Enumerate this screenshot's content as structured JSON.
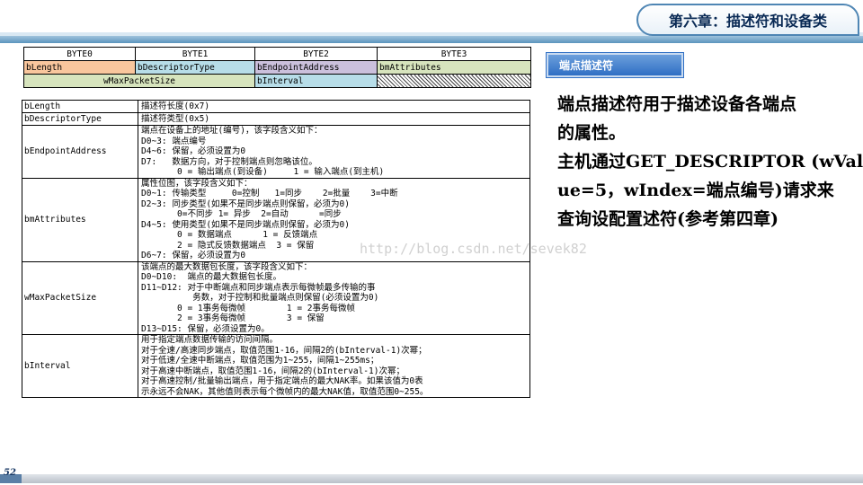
{
  "header": {
    "title": "第六章：描述符和设备类"
  },
  "byte_table": {
    "headers": [
      "BYTE0",
      "BYTE1",
      "BYTE2",
      "BYTE3"
    ],
    "row1": [
      "bLength",
      "bDescriptorType",
      "bEndpointAddress",
      "bmAttributes"
    ],
    "row2": [
      "wMaxPacketSize",
      "bInterval"
    ]
  },
  "fields": [
    {
      "name": "bLength",
      "lines": [
        "描述符长度(0x7)"
      ]
    },
    {
      "name": "bDescriptorType",
      "lines": [
        "描述符类型(0x5)"
      ]
    },
    {
      "name": "bEndpointAddress",
      "lines": [
        "端点在设备上的地址(编号)，该字段含义如下：",
        "D0~3: 端点编号",
        "D4~6: 保留，必须设置为0",
        "D7:   数据方向，对于控制端点则忽略该位。",
        "       0 = 输出端点(到设备)     1 = 输入端点(到主机)"
      ]
    },
    {
      "name": "bmAttributes",
      "lines": [
        "属性位图，该字段含义如下：",
        "D0~1: 传输类型     0=控制   1=同步    2=批量    3=中断",
        "D2~3: 同步类型(如果不是同步端点则保留，必须为0)",
        "       0=不同步 1= 异步  2=自动      =同步",
        "D4~5: 使用类型(如果不是同步端点则保留，必须为0)",
        "       0 = 数据端点      1 = 反馈端点",
        "       2 = 隐式反馈数据端点  3 = 保留",
        "D6~7: 保留，必须设置为0"
      ]
    },
    {
      "name": "wMaxPacketSize",
      "lines": [
        "该端点的最大数据包长度，该字段含义如下：",
        "D0~D10:  端点的最大数据包长度。",
        "D11~D12: 对于中断端点和同步端点表示每微帧最多传输的事",
        "          务数，对于控制和批量端点则保留(必须设置为0)",
        "       0 = 1事务每微帧        1 = 2事务每微帧",
        "       2 = 3事务每微帧        3 = 保留",
        "D13~D15: 保留，必须设置为0。"
      ]
    },
    {
      "name": "bInterval",
      "lines": [
        "用于指定端点数据传输的访问间隔。",
        "对于全速/高速同步端点，取值范围1-16，间隔2的(bInterval-1)次幂；",
        "对于低速/全速中断端点，取值范围为1~255，间隔1~255ms；",
        "对于高速中断端点，取值范围1-16，间隔2的(bInterval-1)次幂；",
        "对于高速控制/批量输出端点，用于指定端点的最大NAK率。如果该值为0表",
        "示永远不会NAK，其他值则表示每个微帧内的最大NAK值，取值范围0~255。"
      ]
    }
  ],
  "sidebar": {
    "label": "端点描述符",
    "text_lines": [
      "端点描述符用于描述设备各端点",
      "的属性。",
      "主机通过GET_DESCRIPTOR (wVal",
      "ue=5，wIndex=端点编号)请求来",
      "查询设配置述符(参考第四章)"
    ]
  },
  "watermark": "http://blog.csdn.net/sevek82",
  "footer": {
    "page_number": "52"
  }
}
